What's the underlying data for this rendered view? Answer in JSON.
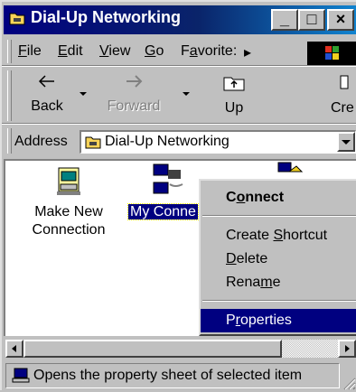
{
  "window": {
    "title": "Dial-Up Networking"
  },
  "title_buttons": {
    "minimize": "_",
    "maximize": "□",
    "close": "×"
  },
  "menubar": {
    "items": [
      {
        "label": "File"
      },
      {
        "label": "Edit"
      },
      {
        "label": "View"
      },
      {
        "label": "Go"
      },
      {
        "label": "Favorite:"
      }
    ],
    "overflow_glyph": "▸"
  },
  "toolbar": {
    "back": {
      "label": "Back",
      "icon": "back-arrow-icon"
    },
    "forward": {
      "label": "Forward",
      "icon": "forward-arrow-icon"
    },
    "up": {
      "label": "Up",
      "icon": "up-folder-icon"
    },
    "create": {
      "label": "Cre"
    }
  },
  "address": {
    "label": "Address",
    "value": "Dial-Up Networking"
  },
  "items": [
    {
      "label_line1": "Make New",
      "label_line2": "Connection",
      "icon": "make-new-connection-icon"
    },
    {
      "label_line1": "My Conne",
      "label_line2": "",
      "icon": "network-computer-icon",
      "selected": true
    },
    {
      "label_line1": "",
      "label_line2": "",
      "icon": "network-computer-icon"
    }
  ],
  "context_menu": {
    "items": [
      {
        "label": "Connect",
        "bold": true
      },
      {
        "label": "Create Shortcut"
      },
      {
        "label": "Delete"
      },
      {
        "label": "Rename"
      },
      {
        "label": "Properties",
        "highlighted": true
      }
    ]
  },
  "status": {
    "text": "Opens the property sheet of selected item"
  },
  "colors": {
    "titlebar": "#000080",
    "face": "#c0c0c0",
    "highlight": "#000080"
  }
}
